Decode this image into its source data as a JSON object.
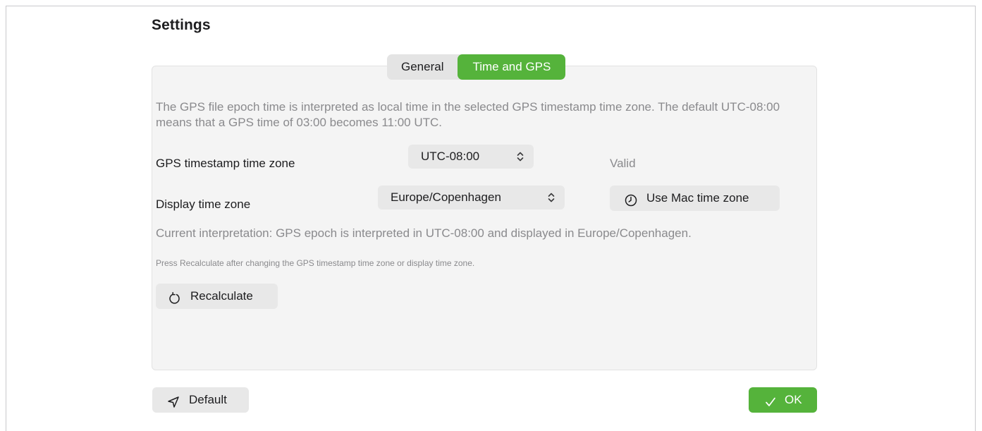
{
  "title": "Settings",
  "tabs": [
    {
      "label": "General",
      "active": false
    },
    {
      "label": "Time and GPS",
      "active": true
    }
  ],
  "description": "The GPS file epoch time is interpreted as local time in the selected GPS timestamp time zone. The default UTC-08:00 means that a GPS time of 03:00 becomes 11:00 UTC.",
  "gps_timezone": {
    "label": "GPS timestamp time zone",
    "value": "UTC-08:00",
    "status": "Valid"
  },
  "display_timezone": {
    "label": "Display time zone",
    "value": "Europe/Copenhagen",
    "use_mac_label": "Use Mac time zone"
  },
  "interpretation": "Current interpretation: GPS epoch is interpreted in UTC-08:00 and displayed in Europe/Copenhagen.",
  "hint": "Press Recalculate after changing the GPS timestamp time zone or display time zone.",
  "recalculate_label": "Recalculate",
  "footer": {
    "default_label": "Default",
    "ok_label": "OK"
  },
  "colors": {
    "accent": "#55b33b",
    "panel_background": "#f4f4f4",
    "button_background": "#e8e8e8",
    "muted_text": "#8a8a8d"
  },
  "icons": {
    "select_indicator": "chevron-up-down-icon",
    "use_mac": "clock-icon",
    "recalculate": "refresh-icon",
    "default": "location-arrow-icon",
    "ok": "checkmark-icon"
  }
}
